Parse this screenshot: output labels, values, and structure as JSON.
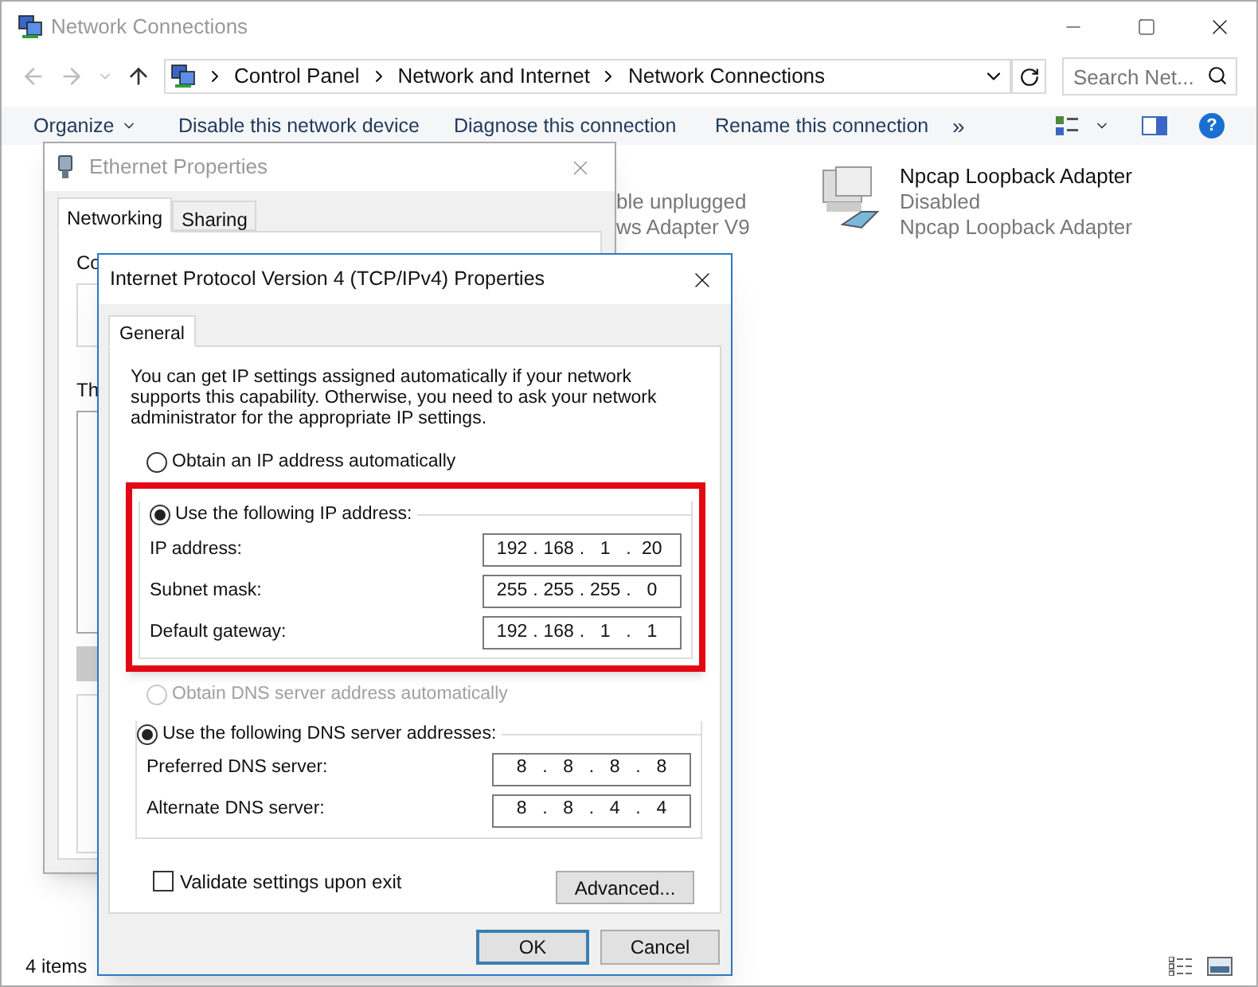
{
  "explorer": {
    "title": "Network Connections",
    "breadcrumb": [
      "Control Panel",
      "Network and Internet",
      "Network Connections"
    ],
    "search": {
      "placeholder": "Search Net..."
    },
    "toolbar": [
      "Organize",
      "Disable this network device",
      "Diagnose this connection",
      "Rename this connection",
      "»"
    ],
    "help": "?",
    "partial_item": {
      "status": "ble unplugged",
      "device": "ws Adapter V9"
    },
    "items": [
      {
        "name": "Npcap Loopback Adapter",
        "status": "Disabled",
        "device": "Npcap Loopback Adapter"
      }
    ],
    "status_bar": "4 items"
  },
  "ethernet_dialog": {
    "title": "Ethernet Properties",
    "tabs": [
      {
        "label": "Networking",
        "selected": true
      },
      {
        "label": "Sharing",
        "selected": false
      }
    ],
    "labels": [
      "Co",
      "Th"
    ]
  },
  "ipv4_dialog": {
    "title": "Internet Protocol Version 4 (TCP/IPv4) Properties",
    "tabs": [
      {
        "label": "General",
        "selected": true
      }
    ],
    "description": "You can get IP settings assigned automatically if your network supports this capability. Otherwise, you need to ask your network administrator for the appropriate IP settings.",
    "separator": ".",
    "ip_options": [
      {
        "label": "Obtain an IP address automatically",
        "selected": false,
        "disabled": false
      },
      {
        "label": "Use the following IP address:",
        "selected": true,
        "disabled": false
      }
    ],
    "ip_fields": [
      {
        "label": "IP address:",
        "octets": [
          "192",
          "168",
          "1",
          "20"
        ]
      },
      {
        "label": "Subnet mask:",
        "octets": [
          "255",
          "255",
          "255",
          "0"
        ]
      },
      {
        "label": "Default gateway:",
        "octets": [
          "192",
          "168",
          "1",
          "1"
        ]
      }
    ],
    "dns_options": [
      {
        "label": "Obtain DNS server address automatically",
        "selected": false,
        "disabled": true
      },
      {
        "label": "Use the following DNS server addresses:",
        "selected": true,
        "disabled": false
      }
    ],
    "dns_fields": [
      {
        "label": "Preferred DNS server:",
        "octets": [
          "8",
          "8",
          "8",
          "8"
        ]
      },
      {
        "label": "Alternate DNS server:",
        "octets": [
          "8",
          "8",
          "4",
          "4"
        ]
      }
    ],
    "validate": {
      "label": "Validate settings upon exit",
      "checked": false
    },
    "buttons": [
      {
        "label": "Advanced...",
        "kind": "advanced"
      },
      {
        "label": "OK",
        "kind": "default"
      },
      {
        "label": "Cancel",
        "kind": "normal"
      }
    ]
  }
}
